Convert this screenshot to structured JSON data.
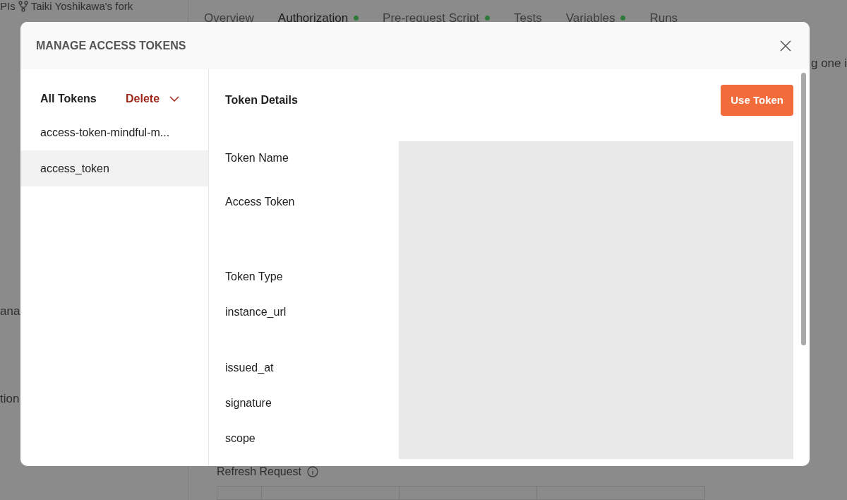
{
  "background": {
    "breadcrumb": "PIs",
    "fork": "Taiki Yoshikawa's fork",
    "tabs": [
      {
        "label": "Overview",
        "selected": false,
        "has_changes": false
      },
      {
        "label": "Authorization",
        "selected": true,
        "has_changes": true
      },
      {
        "label": "Pre-request Script",
        "selected": false,
        "has_changes": true
      },
      {
        "label": "Tests",
        "selected": false,
        "has_changes": false
      },
      {
        "label": "Variables",
        "selected": false,
        "has_changes": true
      },
      {
        "label": "Runs",
        "selected": false,
        "has_changes": false
      }
    ],
    "side_texts": [
      "ana",
      "tion"
    ],
    "right_text": "g one i",
    "refresh_label": "Refresh Request"
  },
  "dialog": {
    "title": "MANAGE ACCESS TOKENS",
    "list_title": "All Tokens",
    "delete_label": "Delete",
    "tokens": [
      {
        "name": "access-token-mindful-m...",
        "selected": false
      },
      {
        "name": "access_token",
        "selected": true
      }
    ],
    "details_title": "Token Details",
    "use_button": "Use Token",
    "fields": [
      "Token Name",
      "Access Token",
      "Token Type",
      "instance_url",
      "issued_at",
      "signature",
      "scope"
    ]
  }
}
